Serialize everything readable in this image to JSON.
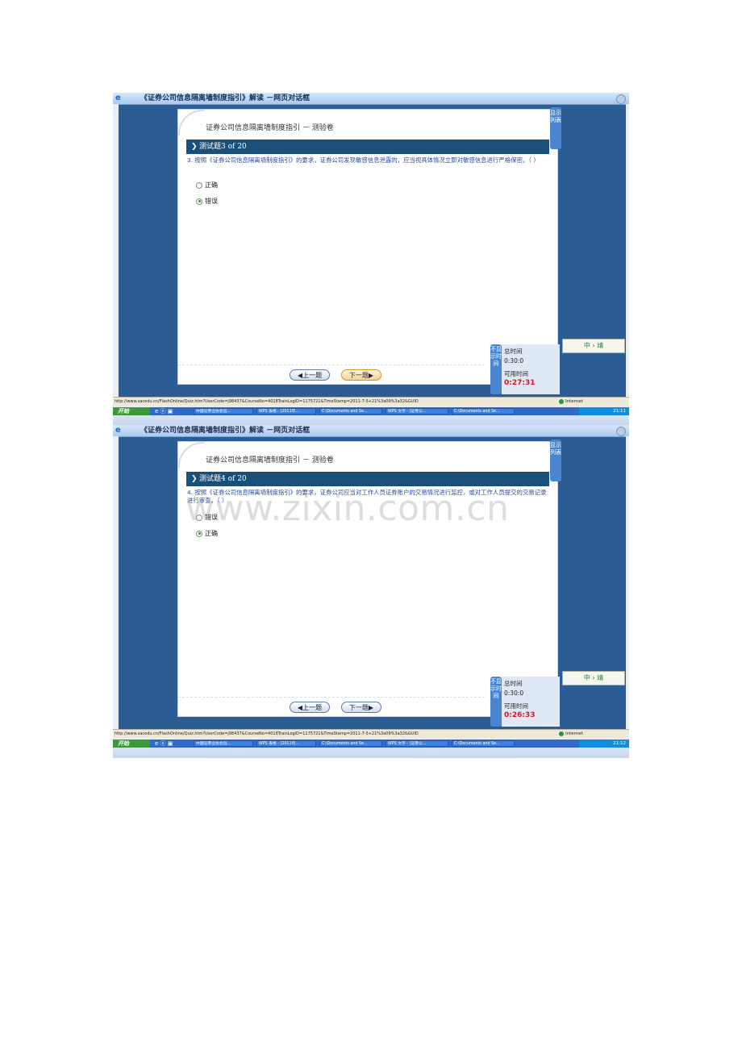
{
  "window_title": "《证券公司信息隔离墙制度指引》解读 －网页对话框",
  "quiz_title": "证券公司信息隔离墙制度指引 － 测验卷",
  "list_tab": "显示列表",
  "timer_tab": "不显示时间",
  "timer": {
    "total_label": "总时间",
    "total_value": "0:30:0",
    "avail_label": "可用时间"
  },
  "nav": {
    "prev": "◀上一题",
    "next": "下一题▶"
  },
  "logo_text": "中 › 靖",
  "status_url": "http://www.sacedu.cn/FlashOnline/Quiz.htm?UserCode=j98437&CourseNo=4018TrainLogID=1175721&TimeStamp=2011-7-5+21%3a09%3a32&GUID",
  "status_zone": "Internet",
  "taskbar": {
    "start": "开始",
    "quick_icons": "e ⓔ ▣",
    "items": [
      "中国证券业协会远...",
      "WPS 表格 - [2011年...",
      "C:\\Documents and Se...",
      "WPS 文字 - [证券公...",
      "C:\\Documents and Se..."
    ]
  },
  "screens": [
    {
      "header": "测试题3 of 20",
      "question": "3. 按照《证券公司信息隔离墙制度指引》的要求，证券公司发现敏感信息泄露的，应当视具体情况立即对敏感信息进行严格保密。（   ）",
      "options": [
        {
          "label": "正确",
          "checked": false
        },
        {
          "label": "错误",
          "checked": true
        }
      ],
      "remaining": "0:27:31",
      "clock": "21:11"
    },
    {
      "header": "测试题4 of 20",
      "question": "4. 按照《证券公司信息隔离墙制度指引》的要求，证券公司应当对工作人员证券账户的交易情况进行监控，或对工作人员提交的交易记录进行审查。（   ）",
      "options": [
        {
          "label": "错误",
          "checked": false
        },
        {
          "label": "正确",
          "checked": true
        }
      ],
      "remaining": "0:26:33",
      "clock": "21:12"
    }
  ],
  "watermark": "www.zixin.com.cn"
}
